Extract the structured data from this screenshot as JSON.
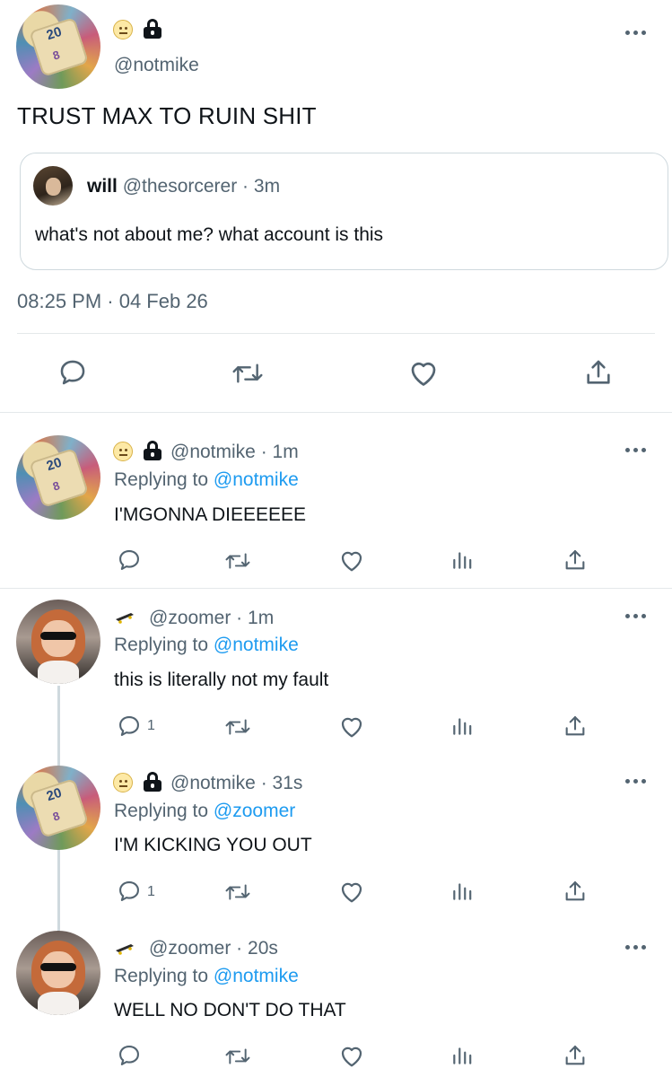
{
  "main_tweet": {
    "handle": "@notmike",
    "text": "TRUST MAX TO RUIN SHIT",
    "quoted": {
      "name": "will",
      "handle": "@thesorcerer",
      "time": "3m",
      "text": "what's not about me? what account is this"
    },
    "timestamp": "08:25 PM · 04 Feb 26"
  },
  "replies": [
    {
      "handle": "@notmike",
      "time": "1m",
      "replying_prefix": "Replying to",
      "replying_to": "@notmike",
      "text": "I'MGONNA DIEEEEEE",
      "reply_count": ""
    },
    {
      "handle": "@zoomer",
      "time": "1m",
      "replying_prefix": "Replying to",
      "replying_to": "@notmike",
      "text": "this is literally not my fault",
      "reply_count": "1"
    },
    {
      "handle": "@notmike",
      "time": "31s",
      "replying_prefix": "Replying to",
      "replying_to": "@zoomer",
      "text": "I'M KICKING YOU OUT",
      "reply_count": "1"
    },
    {
      "handle": "@zoomer",
      "time": "20s",
      "replying_prefix": "Replying to",
      "replying_to": "@notmike",
      "text": "WELL NO DON'T DO THAT",
      "reply_count": ""
    }
  ],
  "sep": " · ",
  "colors": {
    "text": "#0f1419",
    "muted": "#536471",
    "accent": "#1d9bf0",
    "divider": "#e4e8ea"
  },
  "icons": {
    "reply": "speech-bubble-icon",
    "retweet": "retweet-icon",
    "like": "heart-icon",
    "views": "bar-chart-icon",
    "share": "share-icon",
    "more": "more-icon",
    "lock": "lock-icon",
    "emoji": "neutral-face-icon",
    "skateboard": "skateboard-icon"
  }
}
